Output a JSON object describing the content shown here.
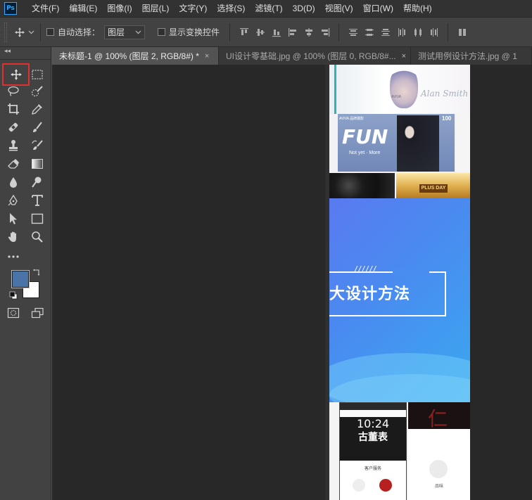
{
  "app": {
    "logo": "Ps"
  },
  "menu": [
    "文件(F)",
    "编辑(E)",
    "图像(I)",
    "图层(L)",
    "文字(Y)",
    "选择(S)",
    "滤镜(T)",
    "3D(D)",
    "视图(V)",
    "窗口(W)",
    "帮助(H)"
  ],
  "options": {
    "auto_select_label": "自动选择：",
    "auto_select_value": "图层",
    "show_transform_label": "显示变换控件"
  },
  "tabs": [
    {
      "label": "未标题-1 @ 100% (图层 2, RGB/8#) *",
      "close": "×"
    },
    {
      "label": "UI设计零基础.jpg @ 100% (图层 0, RGB/8#...",
      "close": "×"
    },
    {
      "label": "测试用例设计方法.jpg @ 1",
      "close": ""
    }
  ],
  "colors": {
    "foreground": "#4a74a8",
    "background": "#ffffff",
    "highlight": "#e03030"
  },
  "canvas": {
    "fashion": {
      "script": "Alan Smith",
      "brand_top": "AVIVA",
      "fun": "FUN",
      "not_yet": "Not yet · More",
      "brand_small": "AVIVA 品牌摄影",
      "hundred": "100"
    },
    "watches": {
      "badge": "PLUS DAY"
    },
    "banner": {
      "slashes": "//////",
      "title": "大设计方法"
    },
    "phones": {
      "time": "10:24",
      "title": "古董表",
      "service": "客户服务",
      "glyph": "仁",
      "caption": "品味"
    }
  }
}
